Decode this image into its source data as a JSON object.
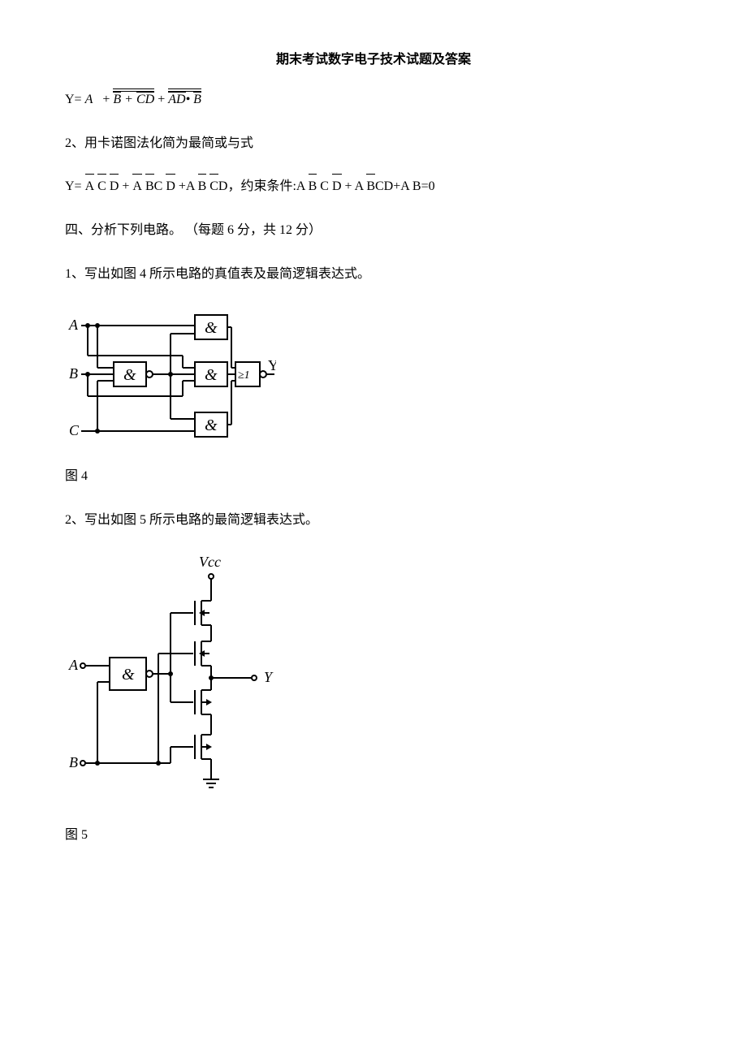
{
  "title": "期末考试数字电子技术试题及答案",
  "eq1_prefix": "Y= ",
  "eq1_var_A": "A",
  "eq1_plus1": " + ",
  "eq1_term2_B": "B",
  "eq1_term2_plus": " + ",
  "eq1_term2_CD": "CD",
  "eq1_plus2": " + ",
  "eq1_term3_AD": "AD",
  "eq1_term3_dot": "•",
  "eq1_term3_B": "B",
  "q2": "2、用卡诺图法化简为最简或与式",
  "eq2_prefix": "Y= ",
  "eq2_A1": "A",
  "eq2_sp1": " ",
  "eq2_C1": "C",
  "eq2_sp2": " ",
  "eq2_D1": "D",
  "eq2_plus1": " + ",
  "eq2_A2": "A",
  "eq2_sp3": " ",
  "eq2_B2": "B",
  "eq2_C2": "C ",
  "eq2_D2": "D",
  "eq2_plusA": " +A ",
  "eq2_B3": "B",
  "eq2_sp4": " ",
  "eq2_C3": "C",
  "eq2_D3": "D",
  "eq2_constraint_label": "，约束条件:A ",
  "eq2_Bc": "B",
  "eq2_Cc": " C   ",
  "eq2_Dc": "D",
  "eq2_plusAc": " +  A ",
  "eq2_Bc2": "B",
  "eq2_tail": "CD+A B=0",
  "section4": "四、分析下列电路。 （每题 6 分，共 12 分）",
  "q4_1": "1、写出如图 4 所示电路的真值表及最简逻辑表达式。",
  "fig4_label": "图 4",
  "q4_2": "2、写出如图 5 所示电路的最简逻辑表达式。",
  "fig5_label": "图 5",
  "circuit1": {
    "inputs": [
      "A",
      "B",
      "C"
    ],
    "output": "Y",
    "gates": {
      "nand1": "&",
      "and1": "&",
      "and2": "&",
      "and3": "&",
      "nor1": "≥1"
    }
  },
  "circuit2": {
    "inputs": [
      "A",
      "B"
    ],
    "output": "Y",
    "vcc": "Vcc",
    "gate": "&"
  }
}
